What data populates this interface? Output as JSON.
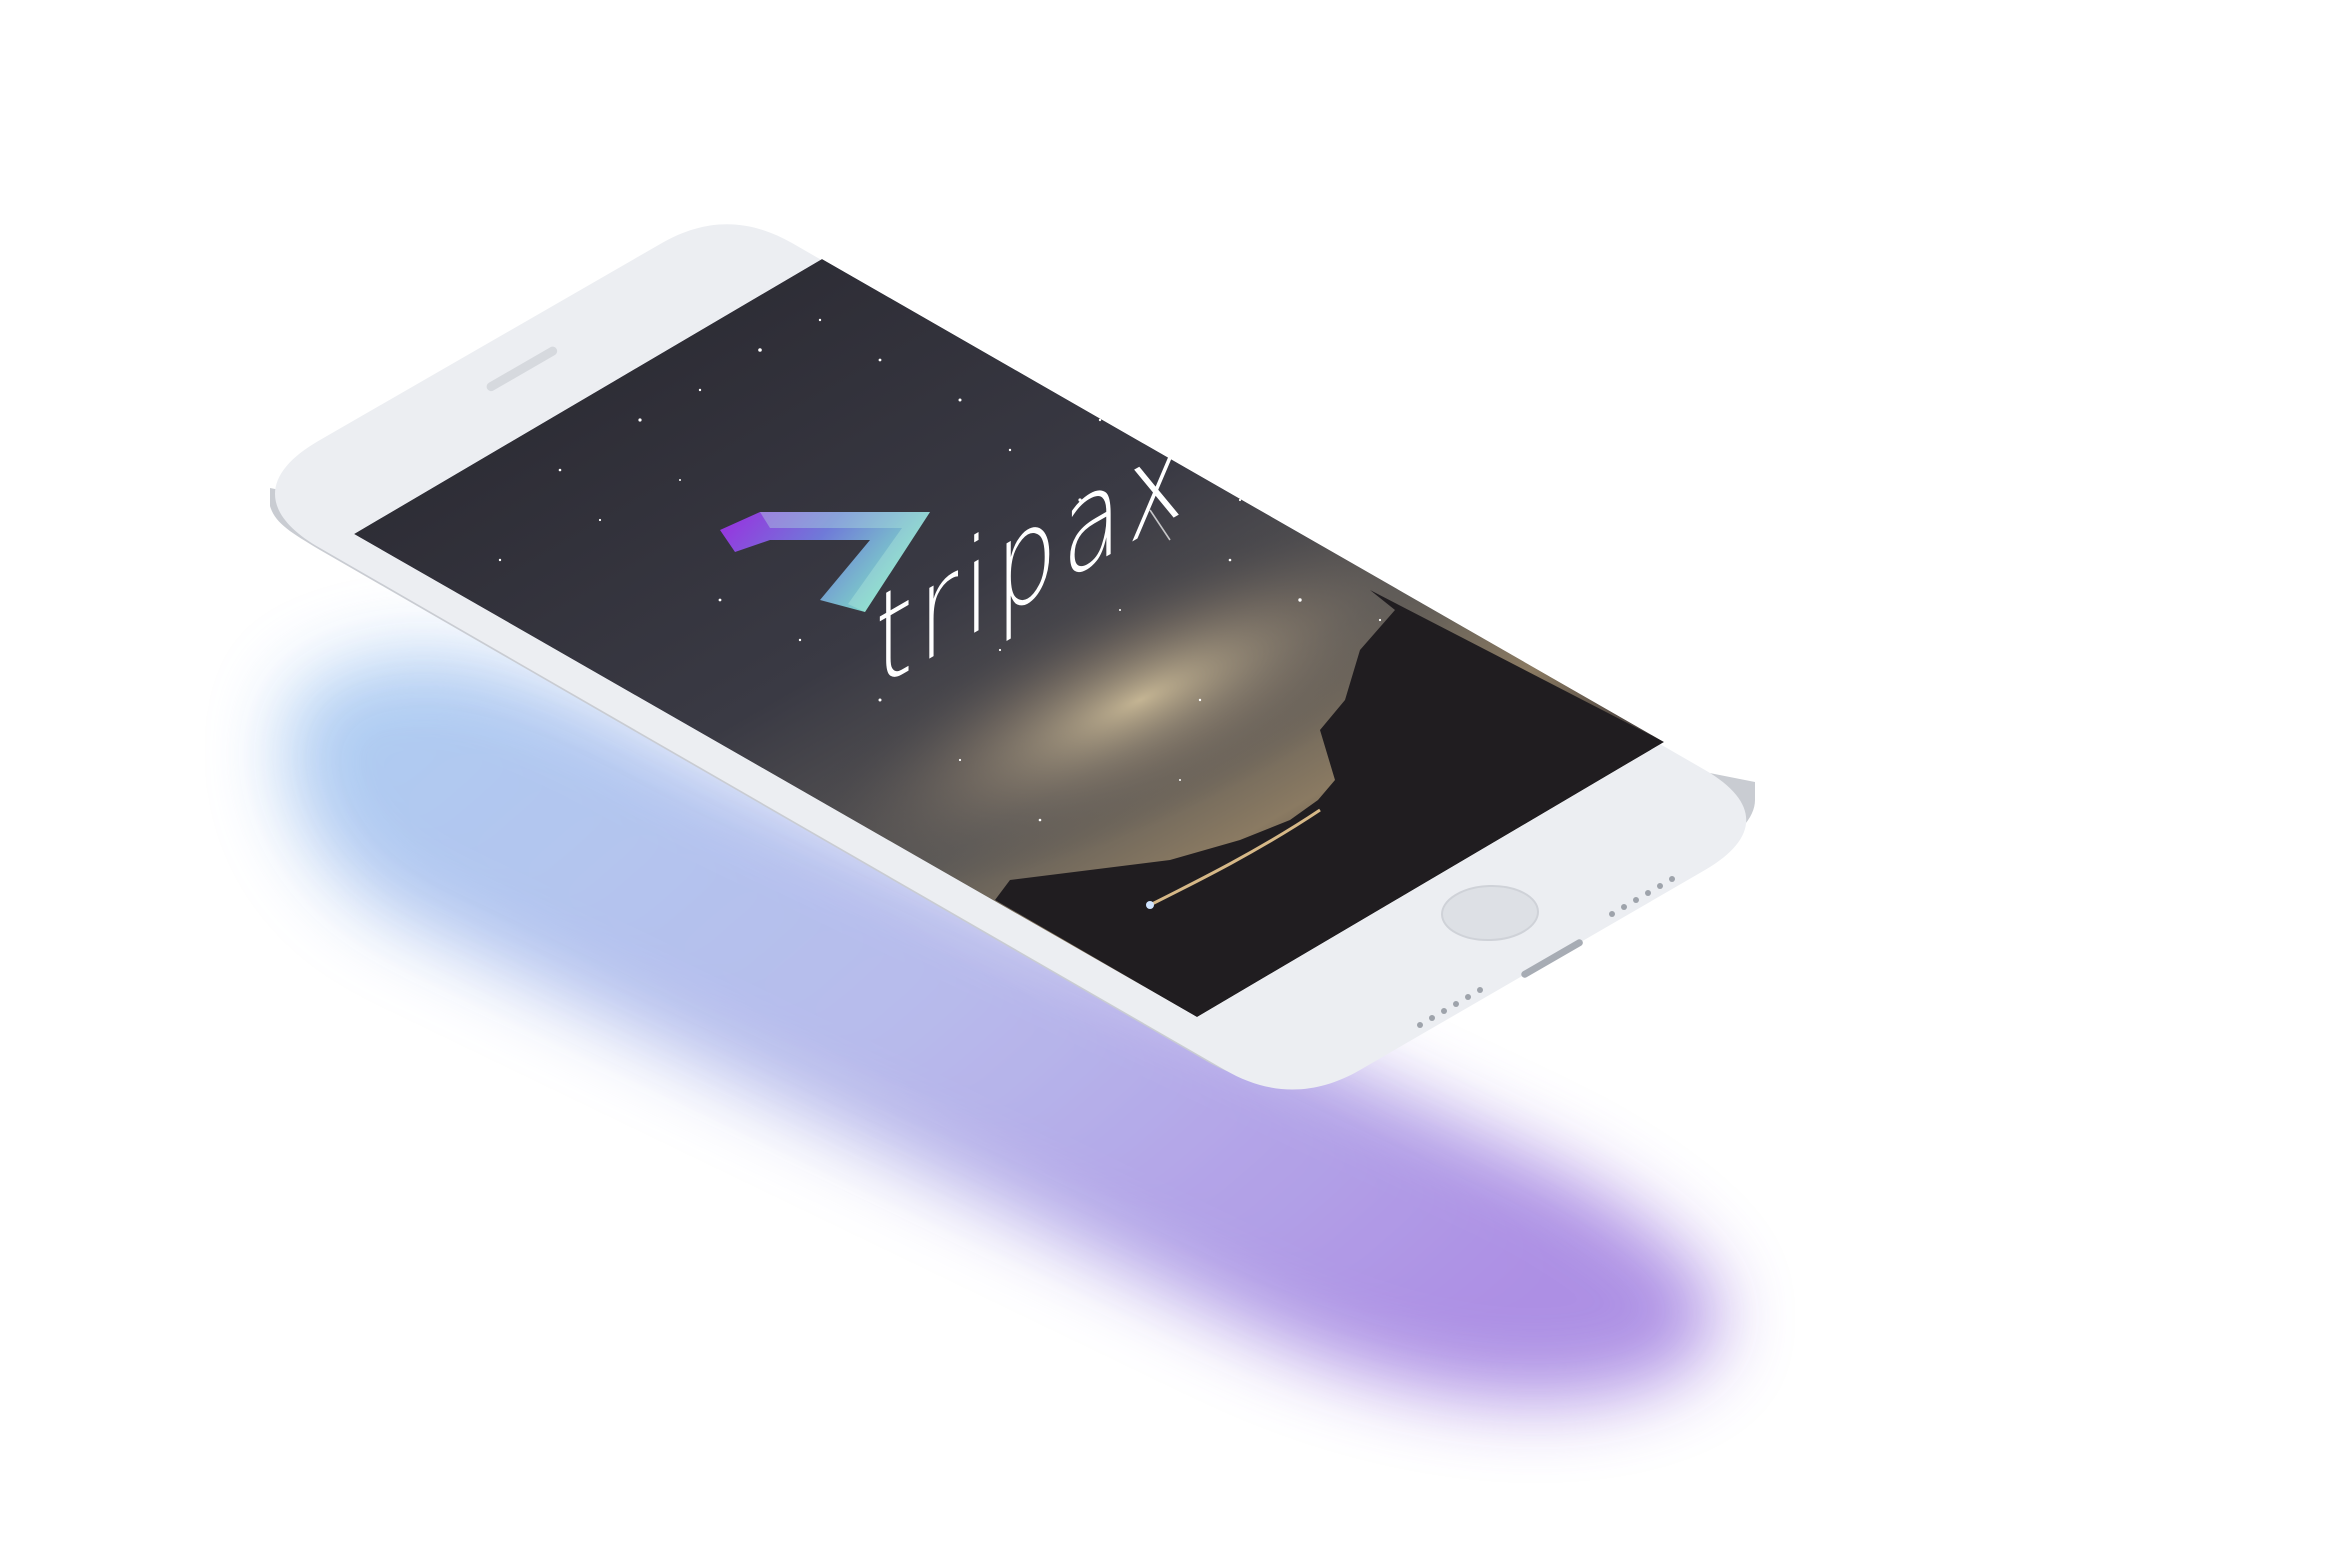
{
  "app": {
    "brand_name": "tripax"
  },
  "colors": {
    "background": "#ffffff",
    "phone_body": "#eceef2",
    "phone_edge": "#c9ccd2",
    "screen_dark": "#1c1b22",
    "logo_gradient_start": "#9b2de0",
    "logo_gradient_end": "#7fe0c6",
    "shadow_blue": "#a9cdf3",
    "shadow_purple": "#a98ae3"
  },
  "icons": {
    "logo": "tripax-triangle-logo",
    "home_button": "home-button",
    "speaker": "earpiece-speaker"
  }
}
